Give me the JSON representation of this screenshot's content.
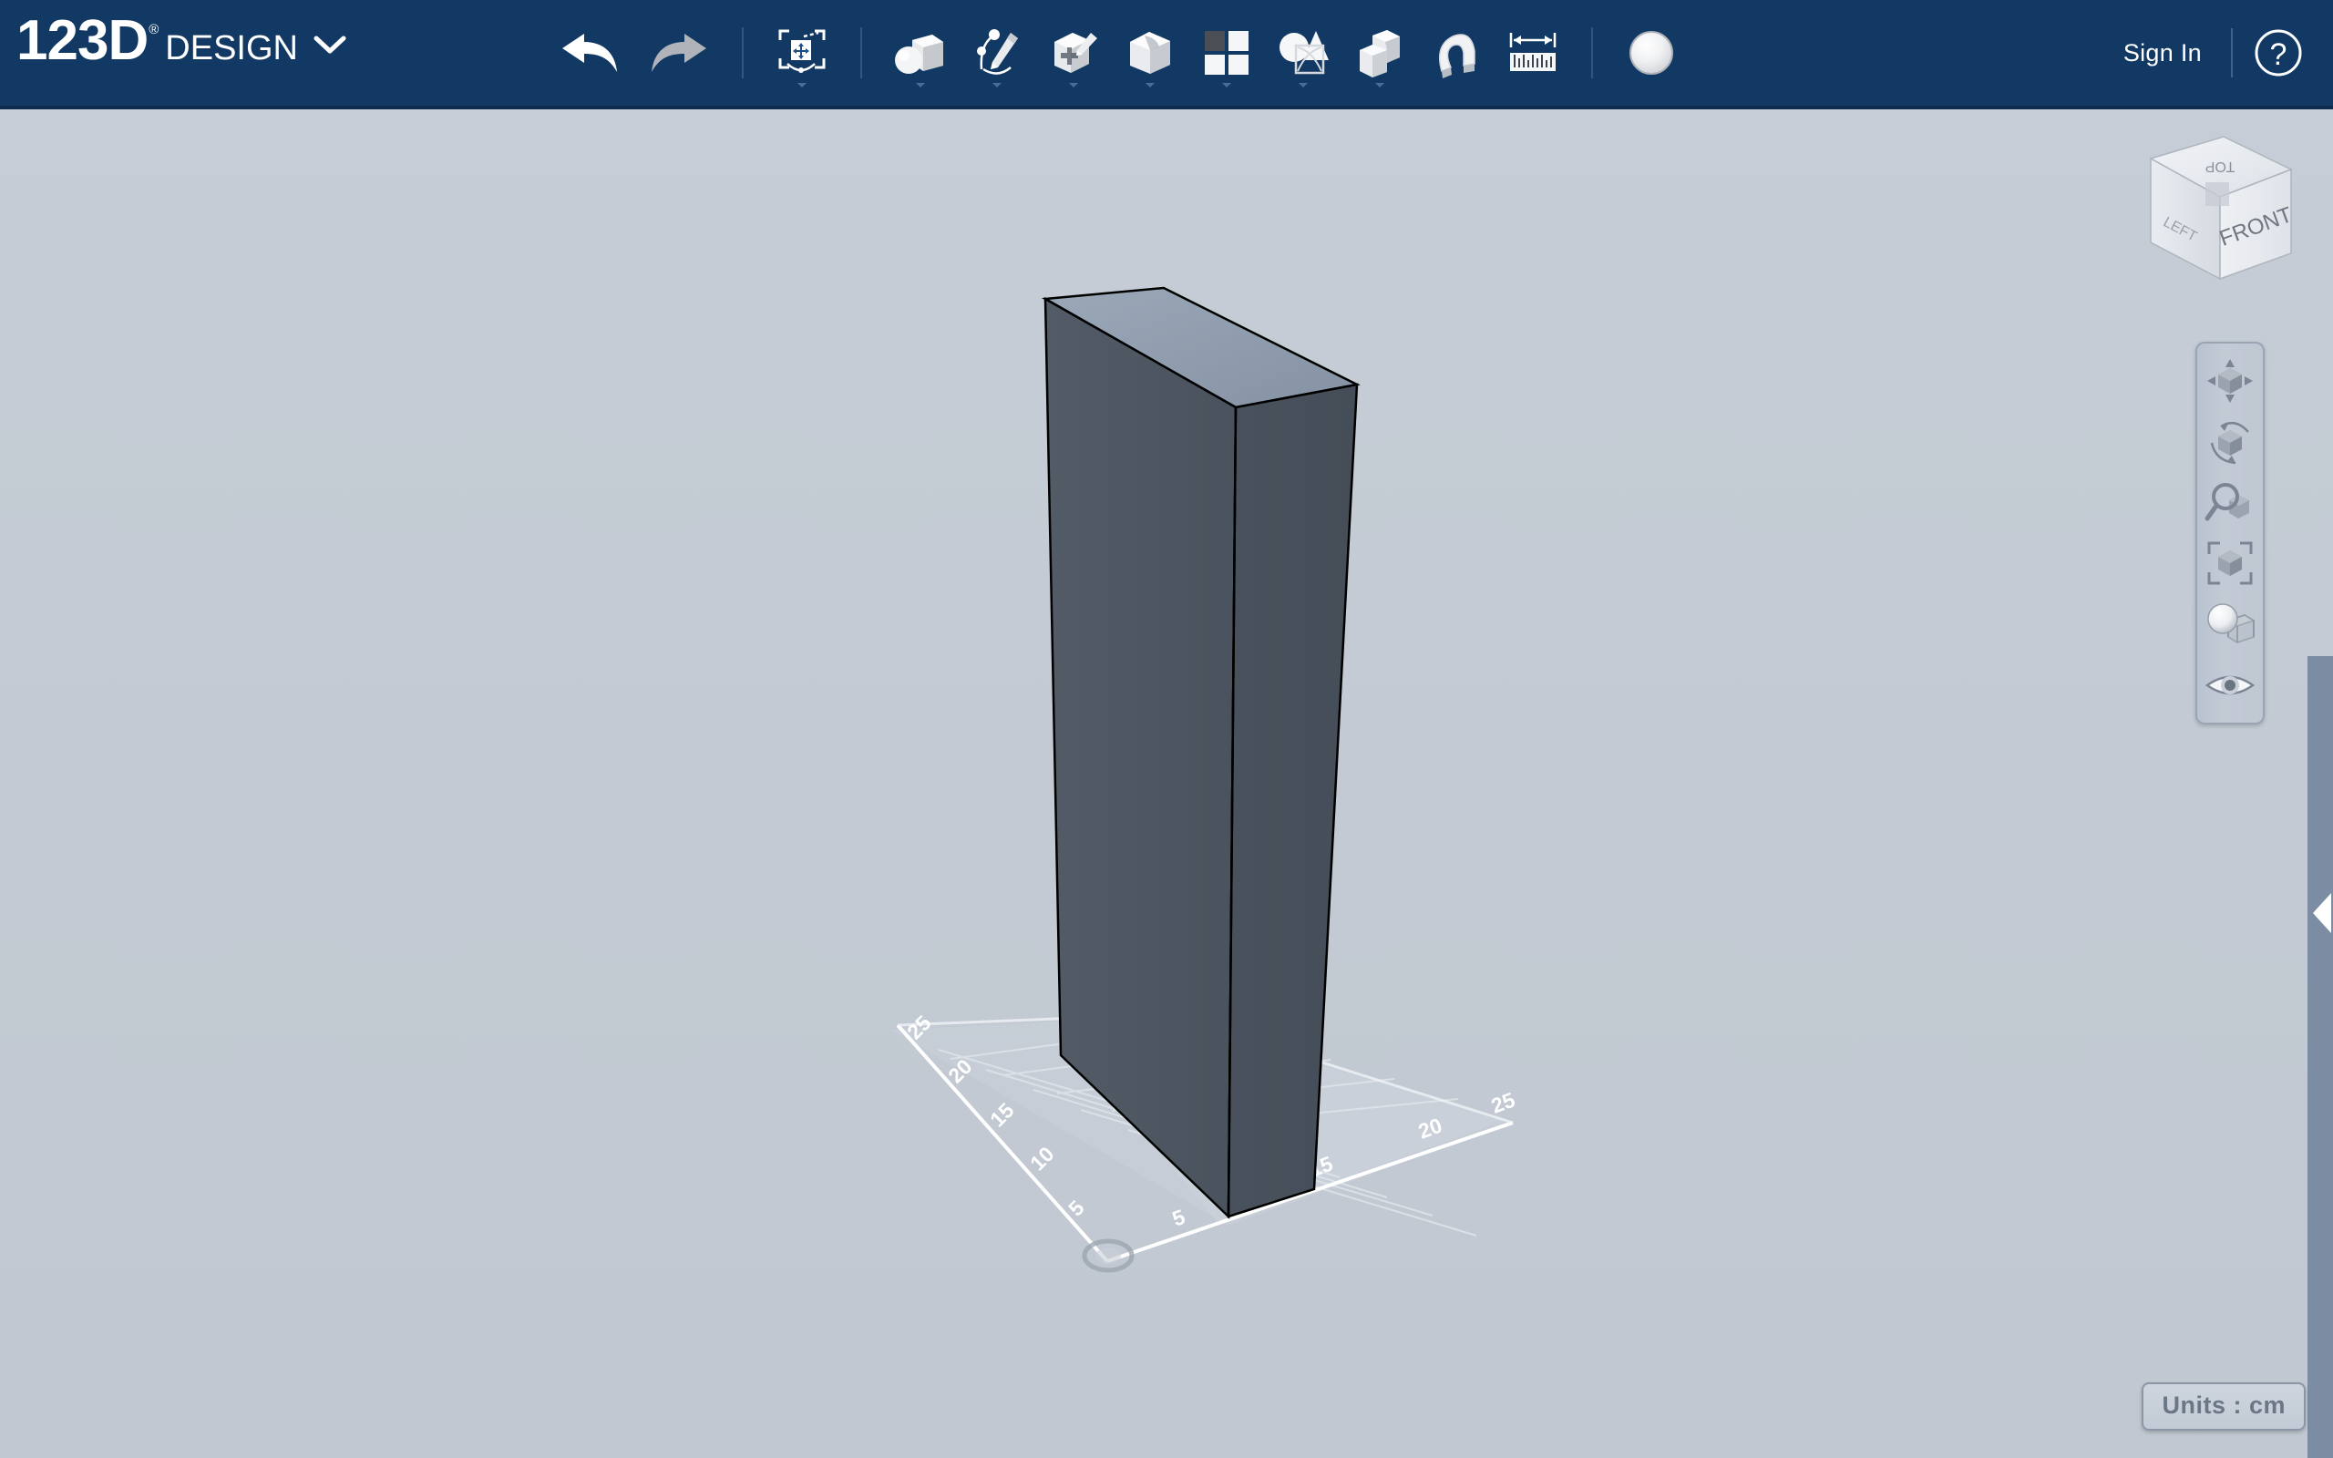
{
  "app": {
    "brand_primary": "123D",
    "brand_secondary": "DESIGN",
    "brand_registered": "®",
    "topbar_color": "#123963",
    "canvas_bg_color": "#c4cbd4"
  },
  "topbar": {
    "logo_menu_icon": "chevron-down-icon",
    "history": [
      {
        "name": "undo-button",
        "icon": "undo-arrow-icon",
        "label": "Undo",
        "enabled": true
      },
      {
        "name": "redo-button",
        "icon": "redo-arrow-icon",
        "label": "Redo",
        "enabled": false
      }
    ],
    "tools": [
      {
        "name": "transform-tool",
        "icon": "transform-move-icon",
        "label": "Transform",
        "has_dropdown": true
      },
      {
        "name": "primitives-tool",
        "icon": "primitives-sphere-cube-icon",
        "label": "Primitives",
        "has_dropdown": true
      },
      {
        "name": "sketch-tool",
        "icon": "sketch-pencil-icon",
        "label": "Sketch",
        "has_dropdown": true
      },
      {
        "name": "construct-tool",
        "icon": "construct-cube-pencil-icon",
        "label": "Construct",
        "has_dropdown": true
      },
      {
        "name": "modify-tool",
        "icon": "modify-fillet-cube-icon",
        "label": "Modify",
        "has_dropdown": true
      },
      {
        "name": "pattern-tool",
        "icon": "pattern-grid-icon",
        "label": "Pattern",
        "has_dropdown": true
      },
      {
        "name": "grouping-tool",
        "icon": "grouping-shapes-icon",
        "label": "Grouping",
        "has_dropdown": true
      },
      {
        "name": "combine-tool",
        "icon": "combine-cubes-icon",
        "label": "Combine",
        "has_dropdown": true
      },
      {
        "name": "snap-tool",
        "icon": "snap-magnet-icon",
        "label": "Snap",
        "has_dropdown": false
      },
      {
        "name": "measure-tool",
        "icon": "measure-ruler-icon",
        "label": "Measure",
        "has_dropdown": false
      },
      {
        "name": "material-tool",
        "icon": "material-sphere-icon",
        "label": "Material",
        "has_dropdown": false
      }
    ],
    "signin_label": "Sign In",
    "help_icon": "question-mark-circle-icon"
  },
  "viewcube": {
    "top_face_label": "TOP",
    "left_face_label": "LEFT",
    "front_face_label": "FRONT"
  },
  "navbar": {
    "buttons": [
      {
        "name": "pan-button",
        "icon": "pan-arrows-cube-icon",
        "label": "Pan"
      },
      {
        "name": "orbit-button",
        "icon": "orbit-rotate-cube-icon",
        "label": "Orbit"
      },
      {
        "name": "zoom-button",
        "icon": "zoom-magnifier-cube-icon",
        "label": "Zoom"
      },
      {
        "name": "fit-button",
        "icon": "fit-to-window-cube-icon",
        "label": "Fit"
      },
      {
        "name": "display-mode-button",
        "icon": "display-sphere-wireframe-icon",
        "label": "Display"
      },
      {
        "name": "visibility-button",
        "icon": "eye-visibility-icon",
        "label": "Visibility"
      }
    ]
  },
  "panel_handle": {
    "icon": "collapse-panel-triangle-icon",
    "strip_color": "#7b8ca3"
  },
  "status": {
    "units_label": "Units : cm"
  },
  "scene": {
    "object": {
      "name": "box-solid",
      "top_face_color": "#8d9cad",
      "front_face_color": "#4e5761",
      "side_face_color": "#454e58",
      "edge_color": "#000000"
    },
    "grid": {
      "plane_color": "#cdd4dc",
      "line_color": "#dfe4ea",
      "axis_color": "#ffffff",
      "origin_marker_icon": "origin-circle-icon",
      "left_axis_ticks": [
        "25",
        "20",
        "15",
        "10",
        "5"
      ],
      "right_axis_ticks": [
        "5",
        "15",
        "20",
        "25"
      ]
    }
  }
}
